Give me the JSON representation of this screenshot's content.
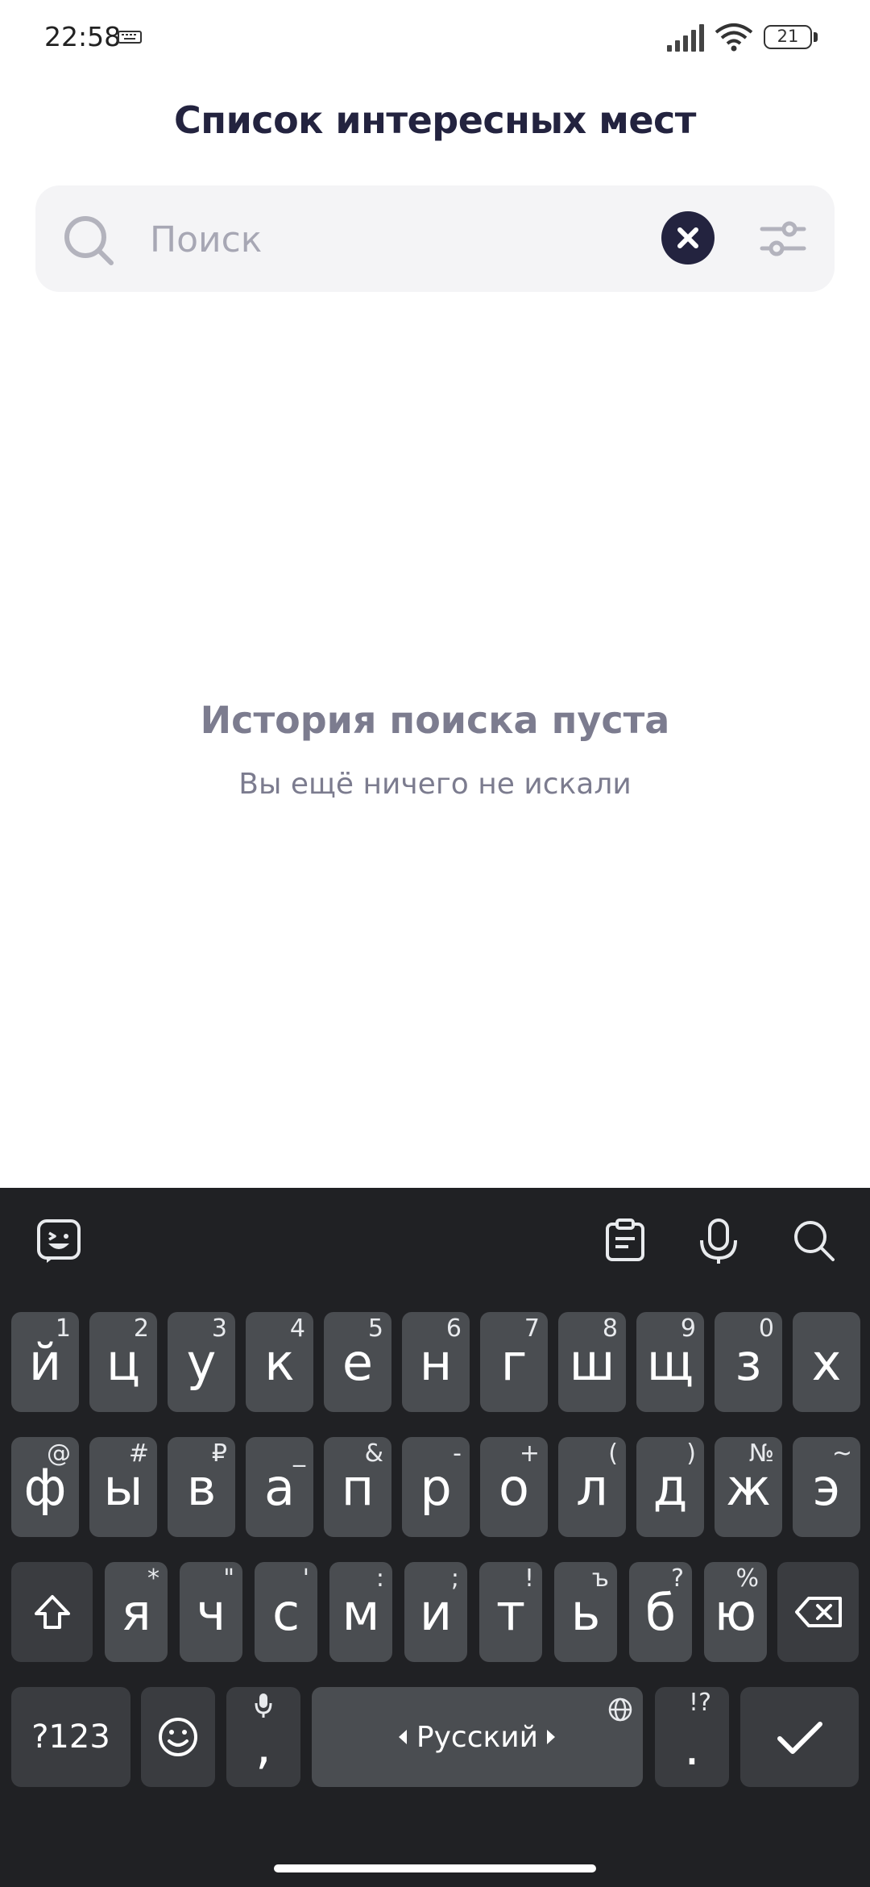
{
  "status_bar": {
    "time": "22:58",
    "battery": "21"
  },
  "header": {
    "title": "Список интересных мест"
  },
  "search": {
    "placeholder": "Поиск",
    "value": ""
  },
  "empty_state": {
    "title": "История поиска пуста",
    "subtitle": "Вы ещё ничего не искали"
  },
  "keyboard": {
    "row1": [
      {
        "key": "й",
        "hint": "1"
      },
      {
        "key": "ц",
        "hint": "2"
      },
      {
        "key": "у",
        "hint": "3"
      },
      {
        "key": "к",
        "hint": "4"
      },
      {
        "key": "е",
        "hint": "5"
      },
      {
        "key": "н",
        "hint": "6"
      },
      {
        "key": "г",
        "hint": "7"
      },
      {
        "key": "ш",
        "hint": "8"
      },
      {
        "key": "щ",
        "hint": "9"
      },
      {
        "key": "з",
        "hint": "0"
      },
      {
        "key": "х",
        "hint": ""
      }
    ],
    "row2": [
      {
        "key": "ф",
        "hint": "@"
      },
      {
        "key": "ы",
        "hint": "#"
      },
      {
        "key": "в",
        "hint": "₽"
      },
      {
        "key": "а",
        "hint": "_"
      },
      {
        "key": "п",
        "hint": "&"
      },
      {
        "key": "р",
        "hint": "-"
      },
      {
        "key": "о",
        "hint": "+"
      },
      {
        "key": "л",
        "hint": "("
      },
      {
        "key": "д",
        "hint": ")"
      },
      {
        "key": "ж",
        "hint": "№"
      },
      {
        "key": "э",
        "hint": "~"
      }
    ],
    "row3": [
      {
        "key": "я",
        "hint": "*"
      },
      {
        "key": "ч",
        "hint": "\""
      },
      {
        "key": "с",
        "hint": "'"
      },
      {
        "key": "м",
        "hint": ":"
      },
      {
        "key": "и",
        "hint": ";"
      },
      {
        "key": "т",
        "hint": "!"
      },
      {
        "key": "ь",
        "hint": "ъ"
      },
      {
        "key": "б",
        "hint": "?"
      },
      {
        "key": "ю",
        "hint": "%"
      }
    ],
    "symbols_label": "?123",
    "comma_label": ",",
    "space_label": "Русский",
    "period_label": ".",
    "period_hint": "!?"
  },
  "icons": {
    "status": [
      "keyboard-icon",
      "signal-icon",
      "wifi-icon",
      "battery-icon"
    ],
    "toolbar": [
      "sticker-icon",
      "clipboard-icon",
      "mic-icon",
      "search-icon"
    ]
  },
  "colors": {
    "accent": "#23233f",
    "muted": "#7c7c8f",
    "keyboard_bg": "#202124",
    "key_bg": "#4a4d51"
  }
}
